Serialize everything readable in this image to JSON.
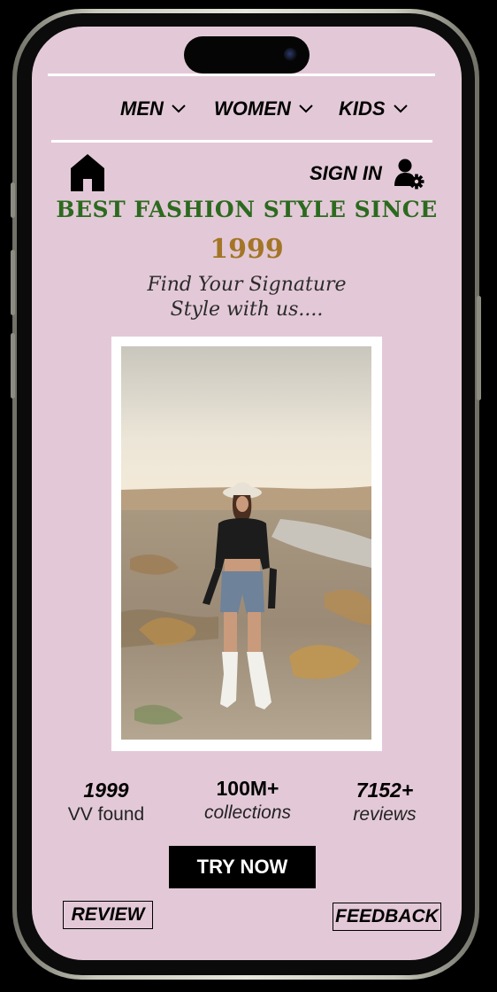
{
  "nav": {
    "items": [
      {
        "label": "MEN",
        "icon": "chevron-down-icon"
      },
      {
        "label": "WOMEN",
        "icon": "chevron-down-icon"
      },
      {
        "label": "KIDS",
        "icon": "chevron-down-icon"
      }
    ]
  },
  "header": {
    "home_icon": "home-icon",
    "signin_label": "SIGN IN",
    "signin_icon": "user-gear-icon"
  },
  "hero": {
    "headline": "BEST FASHION STYLE SINCE",
    "year": "1999",
    "tagline_line1": "Find Your Signature",
    "tagline_line2": "Style with us....",
    "image": "woman-in-cowboy-hat-desert-photo"
  },
  "stats": [
    {
      "value": "1999",
      "label": "VV found"
    },
    {
      "value": "100M+",
      "label": "collections"
    },
    {
      "value": "7152+",
      "label": "reviews"
    }
  ],
  "cta": {
    "try_now": "TRY NOW"
  },
  "footer": {
    "review": "REVIEW",
    "feedback": "FEEDBACK"
  },
  "colors": {
    "screen_bg": "#e3c9d7",
    "headline": "#2c6a1f",
    "year": "#a37526",
    "button_bg": "#000000",
    "button_text": "#ffffff"
  }
}
